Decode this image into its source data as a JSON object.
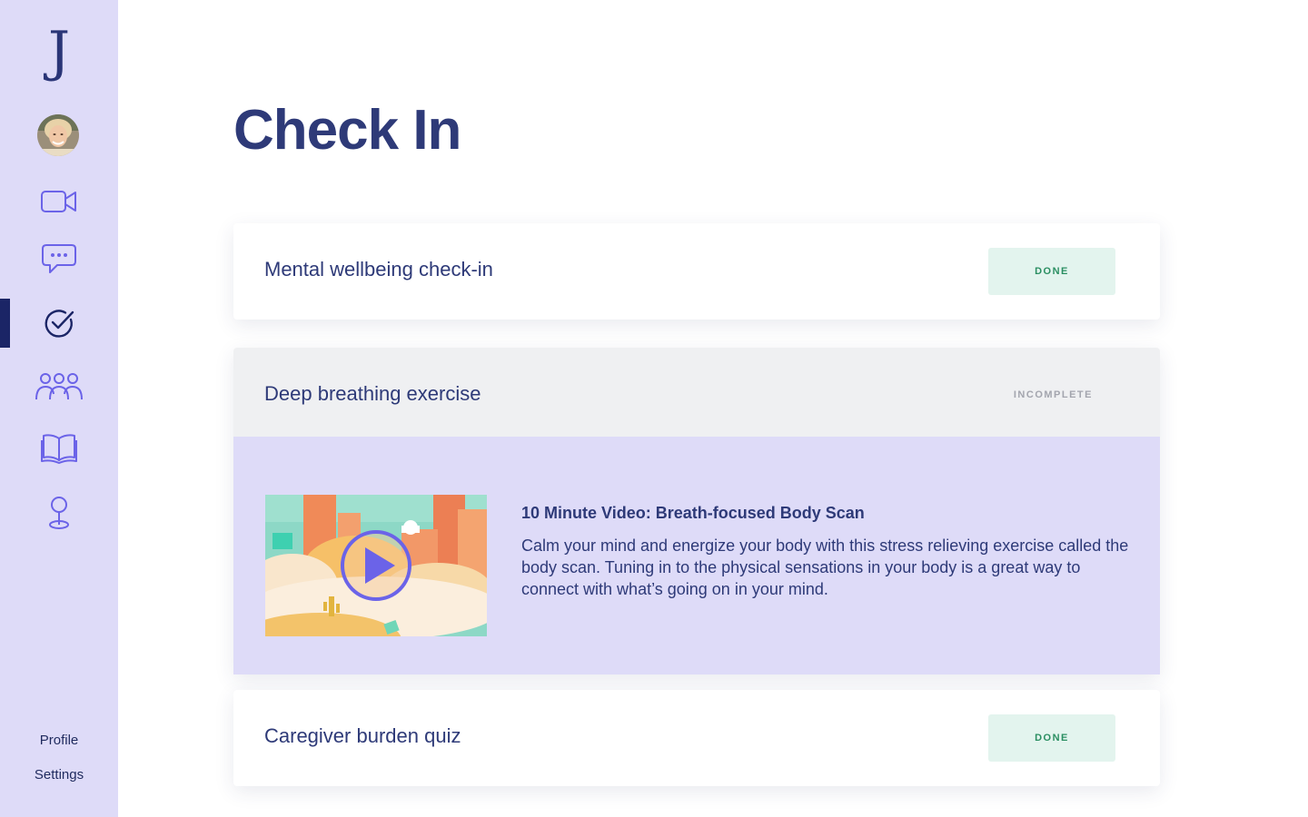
{
  "app": {
    "logo_letter": "J"
  },
  "sidebar": {
    "nav": [
      {
        "name": "video",
        "icon": "video-camera-icon"
      },
      {
        "name": "messages",
        "icon": "chat-bubble-icon"
      },
      {
        "name": "check-in",
        "icon": "check-circle-icon",
        "active": true
      },
      {
        "name": "community",
        "icon": "group-people-icon"
      },
      {
        "name": "library",
        "icon": "open-book-icon"
      },
      {
        "name": "location",
        "icon": "map-pin-icon"
      }
    ],
    "profile_label": "Profile",
    "settings_label": "Settings"
  },
  "page": {
    "title": "Check In"
  },
  "items": [
    {
      "title": "Mental wellbeing check-in",
      "status": "DONE"
    },
    {
      "title": "Deep breathing exercise",
      "status": "INCOMPLETE",
      "video": {
        "title": "10 Minute Video: Breath-focused Body Scan",
        "description": "Calm your mind and energize your body with this stress relieving exercise called the body scan. Tuning in to the physical sensations in your body is a great way to connect with what’s going on in your mind."
      }
    },
    {
      "title": "Caregiver burden quiz",
      "status": "DONE"
    }
  ],
  "colors": {
    "sidebar_bg": "#dedbf8",
    "accent": "#6b63e8",
    "title": "#2e3a78",
    "done_bg": "#e3f4ee",
    "done_text": "#2b8f62",
    "expanded_bg": "#dedbf8"
  }
}
